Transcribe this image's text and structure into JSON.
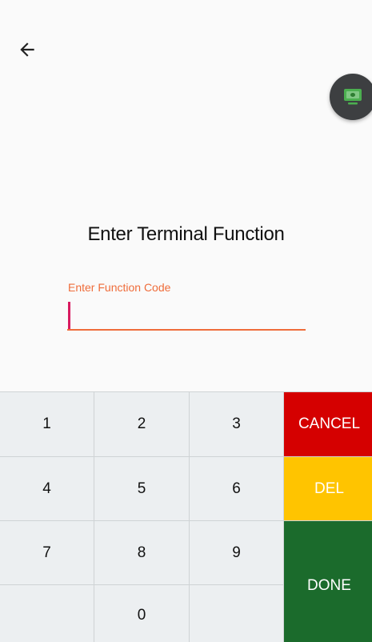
{
  "header": {
    "back_icon": "arrow-left-icon",
    "fab_icon": "monitor-icon",
    "fab_accent": "#4caf50"
  },
  "main": {
    "title": "Enter Terminal Function",
    "field": {
      "label": "Enter Function Code",
      "value": "",
      "accent": "#ef6c3a"
    }
  },
  "keypad": {
    "keys": {
      "k1": "1",
      "k2": "2",
      "k3": "3",
      "k4": "4",
      "k5": "5",
      "k6": "6",
      "k7": "7",
      "k8": "8",
      "k9": "9",
      "k0": "0"
    },
    "cancel_label": "CANCEL",
    "del_label": "DEL",
    "done_label": "DONE",
    "colors": {
      "cancel": "#d50000",
      "del": "#ffc400",
      "done": "#1b6b2c",
      "key": "#eceff1"
    }
  }
}
